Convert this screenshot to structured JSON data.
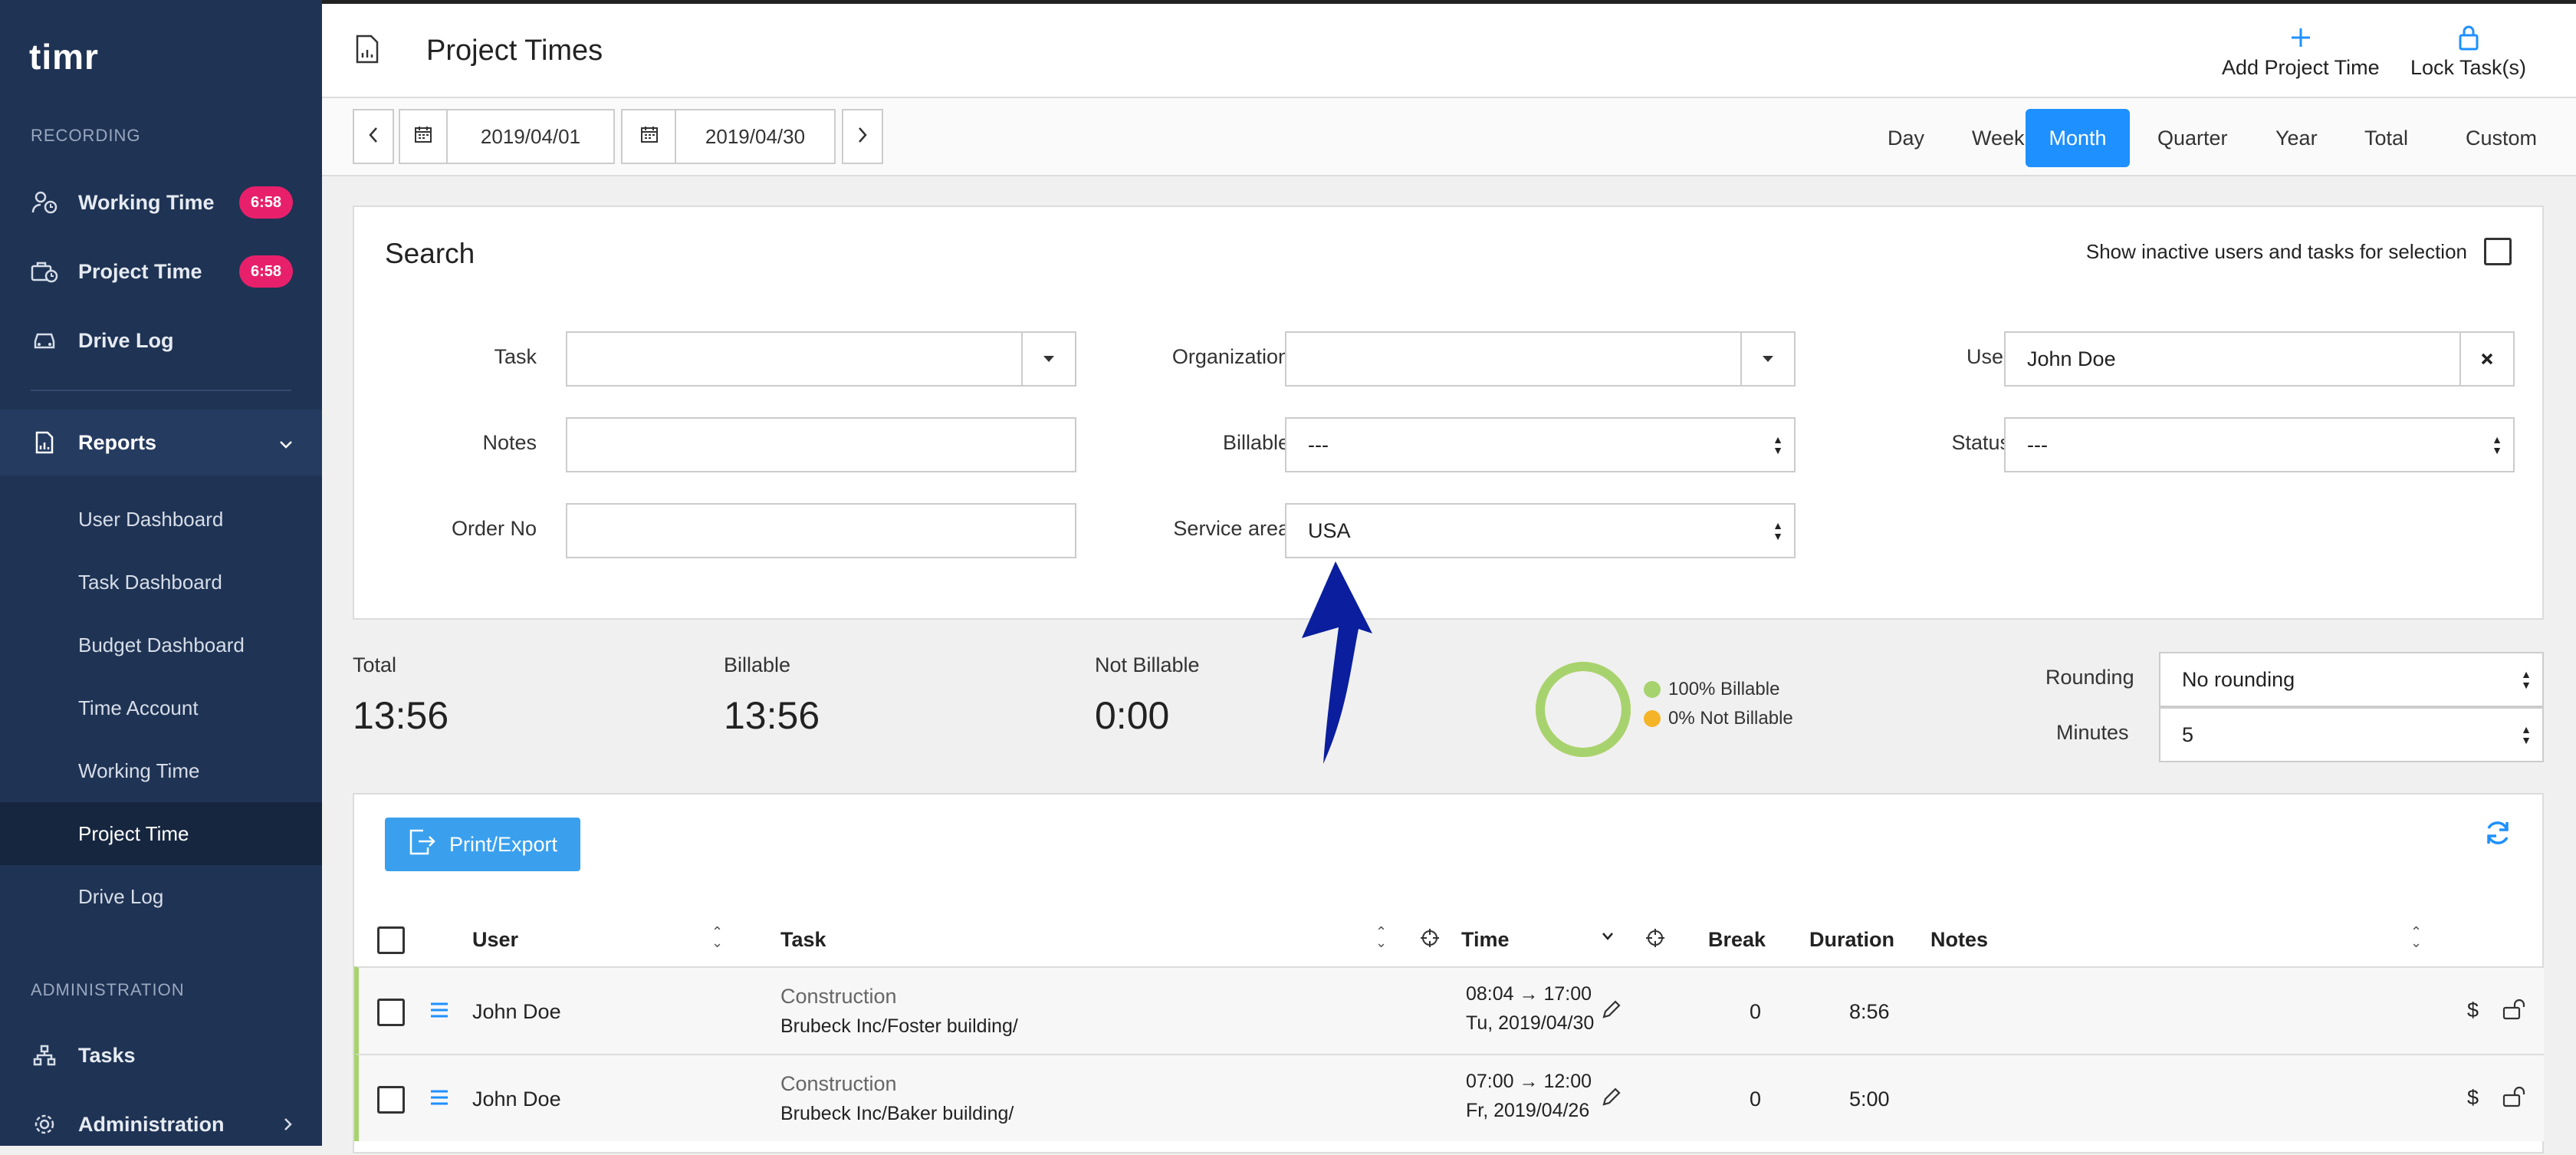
{
  "app": {
    "logo": "timr"
  },
  "sidebar": {
    "recording_head": "RECORDING",
    "recording": [
      {
        "label": "Working Time",
        "badge": "6:58",
        "icon": "user-clock-icon"
      },
      {
        "label": "Project Time",
        "badge": "6:58",
        "icon": "project-clock-icon"
      },
      {
        "label": "Drive Log",
        "icon": "car-icon"
      }
    ],
    "reports": {
      "label": "Reports",
      "icon": "report-icon"
    },
    "report_items": [
      "User Dashboard",
      "Task Dashboard",
      "Budget Dashboard",
      "Time Account",
      "Working Time",
      "Project Time",
      "Drive Log"
    ],
    "admin_head": "ADMINISTRATION",
    "admin": [
      {
        "label": "Tasks",
        "icon": "sitemap-icon"
      },
      {
        "label": "Administration",
        "icon": "gear-icon"
      }
    ]
  },
  "header": {
    "title": "Project Times",
    "add_label": "Add Project Time",
    "lock_label": "Lock Task(s)"
  },
  "dates": {
    "from": "2019/04/01",
    "to": "2019/04/30"
  },
  "periods": [
    "Day",
    "Week",
    "Month",
    "Quarter",
    "Year",
    "Total",
    "Custom"
  ],
  "active_period": "Month",
  "search": {
    "title": "Search",
    "inactive_label": "Show inactive users and tasks for selection",
    "task_label": "Task",
    "task_value": "",
    "organization_label": "Organization",
    "organization_value": "",
    "user_label": "User",
    "user_value": "John Doe",
    "notes_label": "Notes",
    "notes_value": "",
    "billable_label": "Billable",
    "billable_value": "---",
    "status_label": "Status",
    "status_value": "---",
    "orderno_label": "Order No",
    "orderno_value": "",
    "service_label": "Service area",
    "service_value": "USA"
  },
  "summary": {
    "total_label": "Total",
    "total_value": "13:56",
    "billable_label": "Billable",
    "billable_value": "13:56",
    "notbillable_label": "Not Billable",
    "notbillable_value": "0:00",
    "legend_billable": "100% Billable",
    "legend_notbillable": "0% Not Billable",
    "billable_fraction": 1.0,
    "colors": {
      "billable": "#a7d36f",
      "not_billable": "#f5b428"
    },
    "rounding_label": "Rounding",
    "rounding_value": "No rounding",
    "minutes_label": "Minutes",
    "minutes_value": "5"
  },
  "table": {
    "export_label": "Print/Export",
    "headers": {
      "user": "User",
      "task": "Task",
      "time": "Time",
      "break": "Break",
      "duration": "Duration",
      "notes": "Notes"
    },
    "rows": [
      {
        "user": "John Doe",
        "task": "Construction",
        "path": "Brubeck Inc/Foster building/",
        "time": "08:04 → 17:00",
        "date": "Tu, 2019/04/30",
        "break": "0",
        "duration": "8:56"
      },
      {
        "user": "John Doe",
        "task": "Construction",
        "path": "Brubeck Inc/Baker building/",
        "time": "07:00 → 12:00",
        "date": "Fr, 2019/04/26",
        "break": "0",
        "duration": "5:00"
      }
    ]
  },
  "colors": {
    "sidebar": "#1f3354",
    "accent": "#1e90ff",
    "badge": "#e8206b",
    "arrow": "#0a1e9e"
  }
}
